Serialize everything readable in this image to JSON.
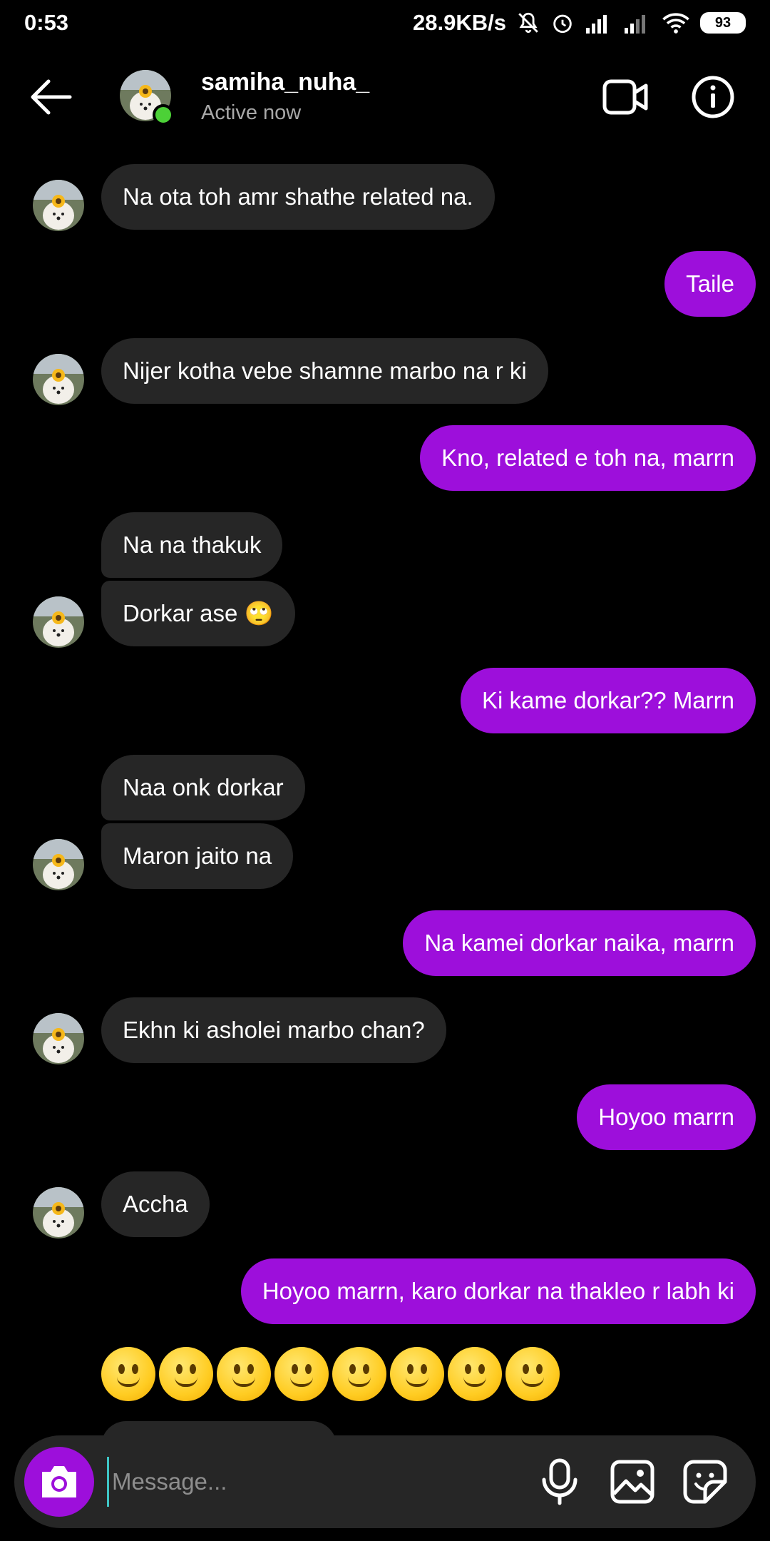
{
  "status_bar": {
    "time": "0:53",
    "network_speed": "28.9KB/s",
    "battery": "93",
    "icons": [
      "mute-icon",
      "alarm-icon",
      "signal-icon",
      "signal-icon",
      "wifi-icon",
      "battery-icon"
    ]
  },
  "header": {
    "username": "samiha_nuha_",
    "status": "Active now",
    "online_color": "#4cd137"
  },
  "colors": {
    "incoming_bubble": "#262626",
    "outgoing_bubble": "#9d0fdb",
    "background": "#000000"
  },
  "messages": [
    {
      "side": "in",
      "text": "Na ota toh amr shathe related na."
    },
    {
      "side": "out",
      "text": "Taile"
    },
    {
      "side": "in",
      "text": "Nijer kotha vebe shamne marbo na r ki"
    },
    {
      "side": "out",
      "text": "Kno, related e toh na, marrn"
    },
    {
      "side": "in",
      "text": "Na na thakuk"
    },
    {
      "side": "in",
      "text": "Dorkar ase 🙄"
    },
    {
      "side": "out",
      "text": "Ki kame dorkar?? Marrn"
    },
    {
      "side": "in",
      "text": "Naa onk dorkar"
    },
    {
      "side": "in",
      "text": "Maron jaito na"
    },
    {
      "side": "out",
      "text": "Na kamei dorkar naika, marrn"
    },
    {
      "side": "in",
      "text": "Ekhn ki asholei marbo chan?"
    },
    {
      "side": "out",
      "text": "Hoyoo marrn"
    },
    {
      "side": "in",
      "text": "Accha"
    },
    {
      "side": "out",
      "text": "Hoyoo marrn, karo dorkar na thakleo r labh ki"
    }
  ],
  "emoji_message": {
    "emoji": "slightly-smiling-face",
    "count": 8
  },
  "composer": {
    "placeholder": "Message..."
  }
}
